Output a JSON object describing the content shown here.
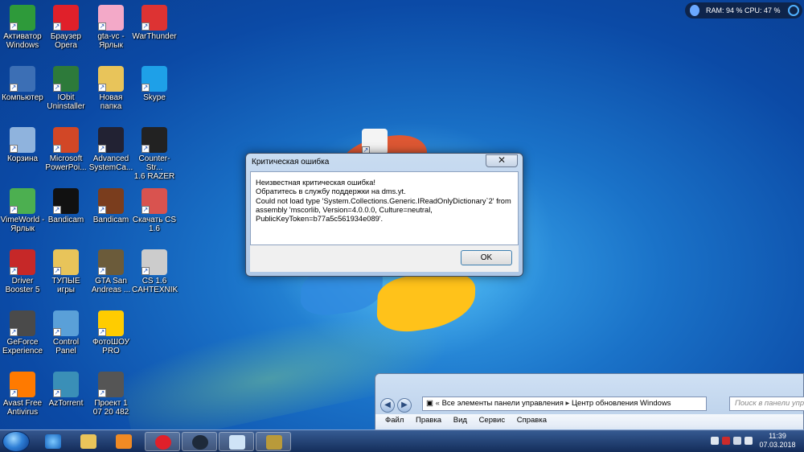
{
  "widget": {
    "text": "RAM: 94 %  CPU: 47 %"
  },
  "desktop_icons": [
    {
      "label": "Активатор\nWindows"
    },
    {
      "label": "Браузер\nOpera"
    },
    {
      "label": "gta-vc -\nЯрлык"
    },
    {
      "label": "WarThunder"
    },
    {
      "label": "Компьютер"
    },
    {
      "label": "IObit\nUninstaller"
    },
    {
      "label": "Новая папка"
    },
    {
      "label": "Skype"
    },
    {
      "label": "Корзина"
    },
    {
      "label": "Microsoft\nPowerPoi..."
    },
    {
      "label": "Advanced\nSystemCa..."
    },
    {
      "label": "Counter-Str...\n1.6 RAZER"
    },
    {
      "label": "VimeWorld -\nЯрлык"
    },
    {
      "label": "Bandicam"
    },
    {
      "label": "Bandicam"
    },
    {
      "label": "Скачать CS\n1.6"
    },
    {
      "label": "Driver\nBooster 5"
    },
    {
      "label": "ТУПЫЕ игры"
    },
    {
      "label": "GTA San\nAndreas ..."
    },
    {
      "label": "CS 1.6\nCAHTEXNIK"
    },
    {
      "label": "GeForce\nExperience"
    },
    {
      "label": "Control\nPanel"
    },
    {
      "label": "ФотоШОУ\nPRO"
    },
    {
      "label": "Avast Free\nAntivirus"
    },
    {
      "label": "AzTorrent"
    },
    {
      "label": "Проект 1\n07 20 482"
    },
    {
      "label": "Новый\nтекстовый ..."
    }
  ],
  "dialog": {
    "title": "Критическая ошибка",
    "close_label": "✕",
    "lines": [
      "Неизвестная критическая ошибка!",
      "Обратитесь в службу поддержки на dms.yt.",
      "Could not load type 'System.Collections.Generic.IReadOnlyDictionary`2' from",
      "assembly 'mscorlib, Version=4.0.0.0, Culture=neutral,",
      "PublicKeyToken=b77a5c561934e089'."
    ],
    "ok_label": "OK"
  },
  "explorer": {
    "address_parts": [
      "Все элементы панели управления",
      "Центр обновления Windows"
    ],
    "search_placeholder": "Поиск в панели упр",
    "menu": [
      "Файл",
      "Правка",
      "Вид",
      "Сервис",
      "Справка"
    ]
  },
  "taskbar": {
    "clock_time": "11:39",
    "clock_date": "07.03.2018"
  }
}
